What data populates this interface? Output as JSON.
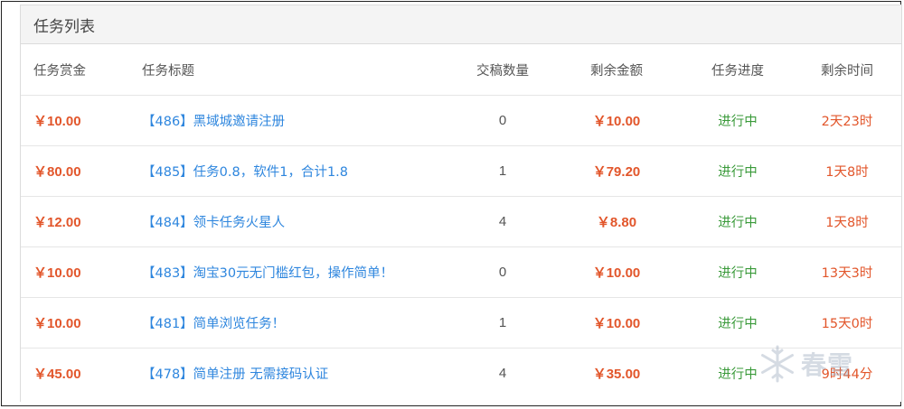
{
  "panel": {
    "title": "任务列表"
  },
  "columns": {
    "reward": "任务赏金",
    "title": "任务标题",
    "count": "交稿数量",
    "remain": "剩余金额",
    "progress": "任务进度",
    "time": "剩余时间"
  },
  "rows": [
    {
      "reward": "￥10.00",
      "title": "【486】黑域城邀请注册",
      "count": "0",
      "remain": "￥10.00",
      "progress": "进行中",
      "time": "2天23时"
    },
    {
      "reward": "￥80.00",
      "title": "【485】任务0.8，软件1，合计1.8",
      "count": "1",
      "remain": "￥79.20",
      "progress": "进行中",
      "time": "1天8时"
    },
    {
      "reward": "￥12.00",
      "title": "【484】领卡任务火星人",
      "count": "4",
      "remain": "￥8.80",
      "progress": "进行中",
      "time": "1天8时"
    },
    {
      "reward": "￥10.00",
      "title": "【483】淘宝30元无门槛红包，操作简单！",
      "count": "0",
      "remain": "￥10.00",
      "progress": "进行中",
      "time": "13天3时"
    },
    {
      "reward": "￥10.00",
      "title": "【481】简单浏览任务！",
      "count": "1",
      "remain": "￥10.00",
      "progress": "进行中",
      "time": "15天0时"
    },
    {
      "reward": "￥45.00",
      "title": "【478】简单注册 无需接码认证",
      "count": "4",
      "remain": "￥35.00",
      "progress": "进行中",
      "time": "9时44分"
    }
  ],
  "watermark": {
    "icon": "snowflake-icon",
    "text": "春雪"
  },
  "colors": {
    "accent_orange": "#e2562b",
    "link_blue": "#2e86de",
    "status_green": "#3a9a3a"
  }
}
